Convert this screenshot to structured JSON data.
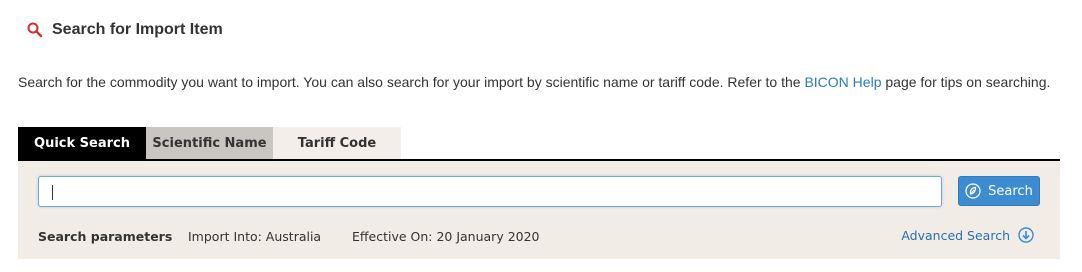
{
  "header": {
    "title": "Search for Import Item",
    "icon": "search-icon"
  },
  "intro": {
    "text_before": "Search for the commodity you want to import. You can also search for your import by scientific name or tariff code. Refer to the ",
    "link_text": "BICON Help",
    "text_after": " page for tips on searching."
  },
  "tabs": [
    {
      "label": "Quick Search",
      "active": true
    },
    {
      "label": "Scientific Name",
      "active": false
    },
    {
      "label": "Tariff Code",
      "active": false
    }
  ],
  "search": {
    "value": "",
    "placeholder": "",
    "button_label": "Search",
    "button_icon": "leaf-circle-icon"
  },
  "parameters": {
    "label": "Search parameters",
    "import_into": "Import Into: Australia",
    "effective_on": "Effective On: 20 January 2020",
    "advanced_label": "Advanced Search",
    "advanced_icon": "arrow-down-circle-icon"
  },
  "colors": {
    "accent": "#3d8bd0",
    "link": "#2b7bb9",
    "header_icon": "#d0312d",
    "panel_bg": "#f2ece7",
    "active_tab_bg": "#000000"
  }
}
